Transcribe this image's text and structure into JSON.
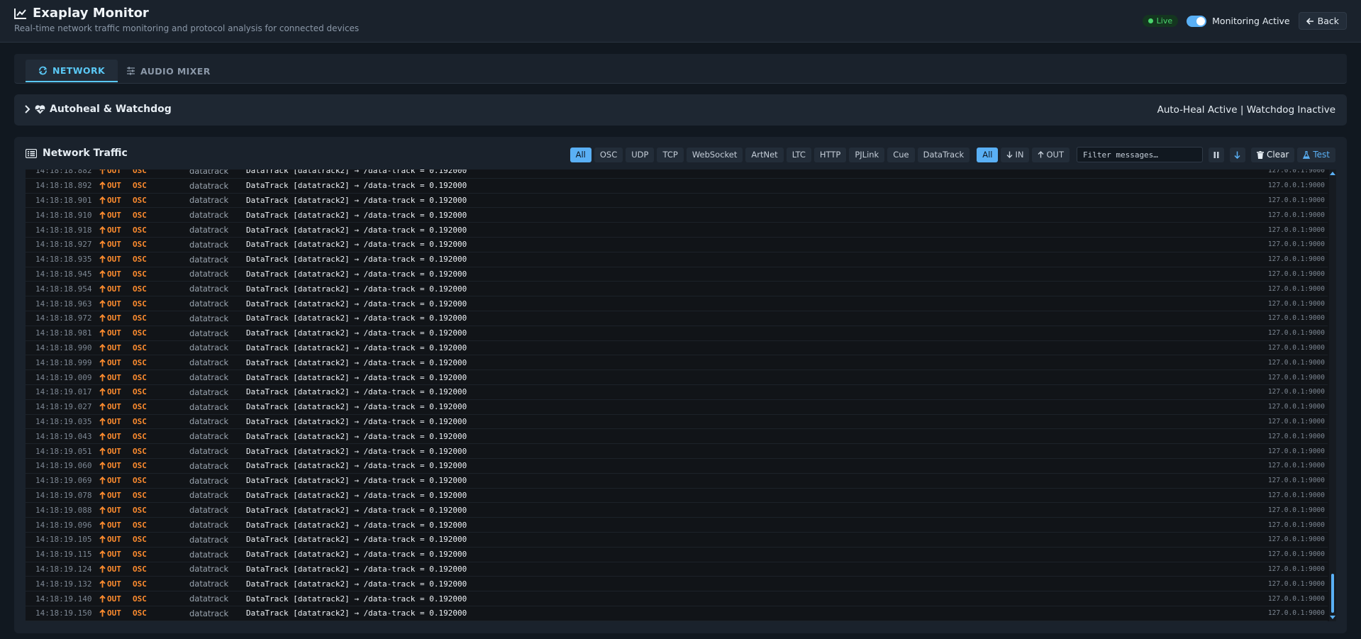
{
  "header": {
    "title": "Exaplay Monitor",
    "subtitle": "Real-time network traffic monitoring and protocol analysis for connected devices",
    "live_label": "Live",
    "monitoring_label": "Monitoring Active",
    "back_label": "Back"
  },
  "tabs": [
    {
      "label": "NETWORK",
      "active": true
    },
    {
      "label": "AUDIO MIXER",
      "active": false
    }
  ],
  "autoheal": {
    "title": "Autoheal & Watchdog",
    "status": "Auto-Heal Active | Watchdog Inactive"
  },
  "traffic": {
    "title": "Network Traffic",
    "protocol_filters": [
      "All",
      "OSC",
      "UDP",
      "TCP",
      "WebSocket",
      "ArtNet",
      "LTC",
      "HTTP",
      "PJLink",
      "Cue",
      "DataTrack"
    ],
    "direction_filters": [
      "All",
      "IN",
      "OUT"
    ],
    "filter_placeholder": "Filter messages…",
    "clear_label": "Clear",
    "test_label": "Test"
  },
  "log": {
    "direction": "OUT",
    "protocol": "OSC",
    "source": "datatrack",
    "message": "DataTrack [datatrack2] → /data-track = 0.192000",
    "address": "127.0.0.1:9000",
    "times": [
      "14:18:18.882",
      "14:18:18.892",
      "14:18:18.901",
      "14:18:18.910",
      "14:18:18.918",
      "14:18:18.927",
      "14:18:18.935",
      "14:18:18.945",
      "14:18:18.954",
      "14:18:18.963",
      "14:18:18.972",
      "14:18:18.981",
      "14:18:18.990",
      "14:18:18.999",
      "14:18:19.009",
      "14:18:19.017",
      "14:18:19.027",
      "14:18:19.035",
      "14:18:19.043",
      "14:18:19.051",
      "14:18:19.060",
      "14:18:19.069",
      "14:18:19.078",
      "14:18:19.088",
      "14:18:19.096",
      "14:18:19.105",
      "14:18:19.115",
      "14:18:19.124",
      "14:18:19.132",
      "14:18:19.140",
      "14:18:19.150"
    ]
  },
  "colors": {
    "accent": "#5ab0f5",
    "out_orange": "#ff8c2e",
    "live_green": "#4ad66d"
  }
}
